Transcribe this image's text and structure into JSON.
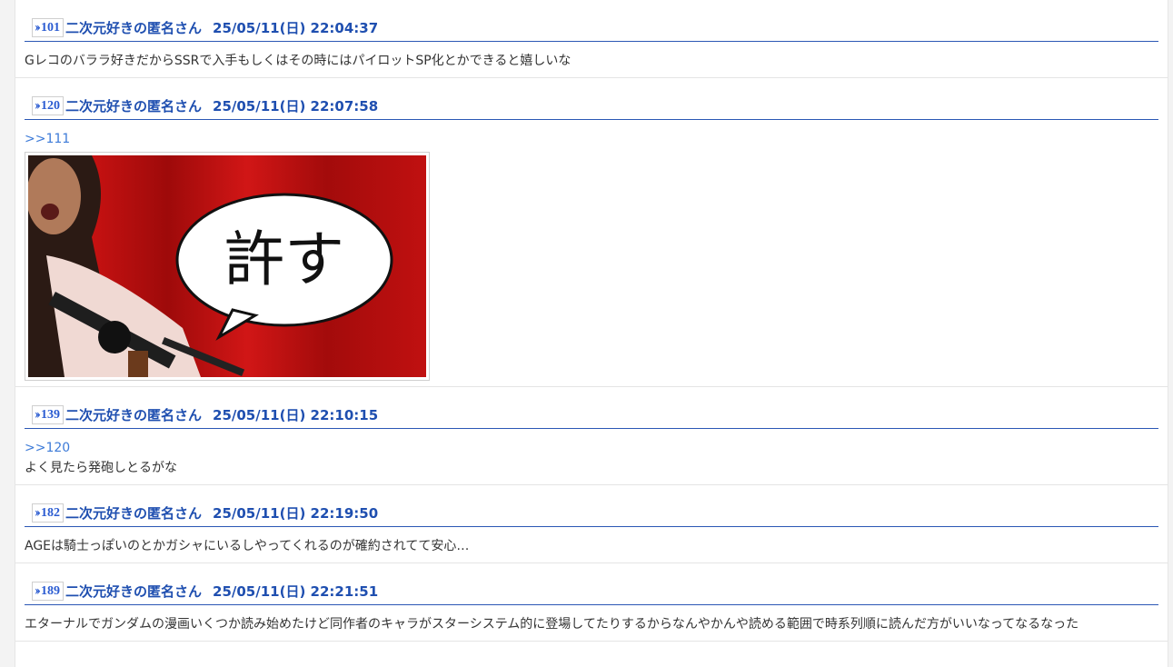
{
  "thread": {
    "posts": [
      {
        "number": "101",
        "name": "二次元好きの匿名さん",
        "date": "25/05/11(日) 22:04:37",
        "reply_to": "",
        "text": "Gレコのバララ好きだからSSRで入手もしくはその時にはパイロットSP化とかできると嬉しいな"
      },
      {
        "number": "120",
        "name": "二次元好きの匿名さん",
        "date": "25/05/11(日) 22:07:58",
        "reply_to": ">>111",
        "text": "",
        "image": {
          "caption": "許す"
        }
      },
      {
        "number": "139",
        "name": "二次元好きの匿名さん",
        "date": "25/05/11(日) 22:10:15",
        "reply_to": ">>120",
        "text": "よく見たら発砲しとるがな"
      },
      {
        "number": "182",
        "name": "二次元好きの匿名さん",
        "date": "25/05/11(日) 22:19:50",
        "reply_to": "",
        "text": "AGEは騎士っぽいのとかガシャにいるしやってくれるのが確約されてて安心…"
      },
      {
        "number": "189",
        "name": "二次元好きの匿名さん",
        "date": "25/05/11(日) 22:21:51",
        "reply_to": "",
        "text": "エターナルでガンダムの漫画いくつか読み始めたけど同作者のキャラがスターシステム的に登場してたりするからなんやかんや読める範囲で時系列順に読んだ方がいいなってなるなった"
      }
    ],
    "colors": {
      "header_link": "#1f4fb0",
      "reply_link": "#3d7bd8",
      "divider": "#2b57b5"
    }
  },
  "icons": {
    "anchor": "double-chevron-icon"
  }
}
